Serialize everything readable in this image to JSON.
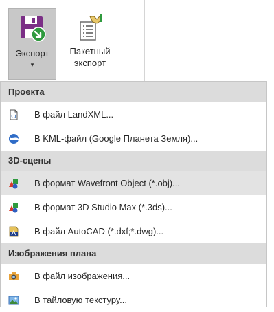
{
  "ribbon": {
    "export_label": "Экспорт",
    "caret": "▾",
    "batch_label_1": "Пакетный",
    "batch_label_2": "экспорт"
  },
  "menu": {
    "sections": [
      {
        "title": "Проекта",
        "items": [
          {
            "label": "В файл LandXML...",
            "icon": "landxml-file-icon"
          },
          {
            "label": "В KML-файл (Google Планета Земля)...",
            "icon": "globe-icon"
          }
        ]
      },
      {
        "title": "3D-сцены",
        "items": [
          {
            "label": "В формат Wavefront Object (*.obj)...",
            "icon": "3d-shapes-icon"
          },
          {
            "label": "В формат 3D Studio Max (*.3ds)...",
            "icon": "3d-shapes-icon"
          },
          {
            "label": "В файл AutoCAD (*.dxf;*.dwg)...",
            "icon": "autocad-file-icon"
          }
        ]
      },
      {
        "title": "Изображения плана",
        "items": [
          {
            "label": "В файл изображения...",
            "icon": "camera-icon"
          },
          {
            "label": "В тайловую текстуру...",
            "icon": "picture-icon"
          }
        ]
      }
    ]
  },
  "colors": {
    "header_bg": "#dcdcdc",
    "hover_bg": "#e3e3e3",
    "export_icon_purple": "#7b2f86",
    "export_icon_green": "#2f9a3e"
  }
}
